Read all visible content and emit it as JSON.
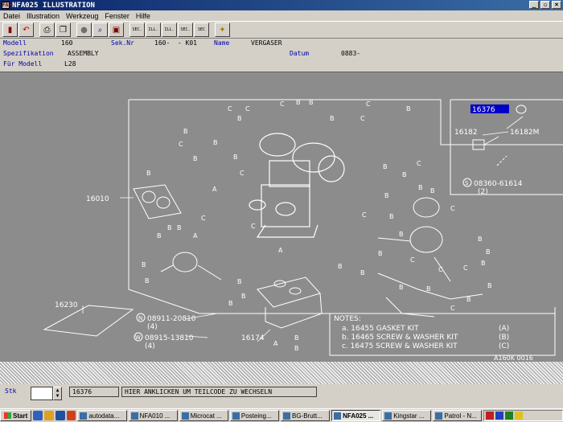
{
  "window": {
    "title": "NFA025 ILLUSTRATION",
    "app_icon": "FAST"
  },
  "menu": [
    "Datei",
    "Illustration",
    "Werkzeug",
    "Fenster",
    "Hilfe"
  ],
  "toolbar": {
    "sec_prev": "SEC.",
    "ill_prev": "ILL.",
    "ill_next": "ILL.",
    "sec_next": "SEC.",
    "sec_up": "SEC"
  },
  "info": {
    "modell_label": "Modell",
    "modell_value": "160",
    "seknr_label": "Sek.Nr",
    "seknr_value": "160-  - K01",
    "name_label": "Name",
    "name_value": "VERGASER",
    "spez_label": "Spezifikation",
    "spez_value": "ASSEMBLY",
    "datum_label": "Datum",
    "datum_value": "0883-",
    "fuer_label": "Für Modell",
    "fuer_value": "L28"
  },
  "illustration": {
    "callouts": {
      "c16376": "16376",
      "c16182": "16182",
      "c16182m": "16182M",
      "c08360": "08360-61614",
      "c08360_qty": "(2)",
      "c16010": "16010",
      "c16230": "16230",
      "c08911": "08911-20810",
      "c08911_qty": "(4)",
      "c08915": "08915-13810",
      "c08915_qty": "(4)",
      "c16174": "16174",
      "bolt_s": "S",
      "nut_n": "N",
      "washer_w": "W"
    },
    "notes": {
      "title": "NOTES:",
      "a": "a. 16455 GASKET KIT",
      "a_tag": "(A)",
      "b": "b. 16465 SCREW & WASHER KIT",
      "b_tag": "(B)",
      "c": "c. 16475 SCREW & WASHER KIT",
      "c_tag": "(C)"
    },
    "ref": "A160K 0016"
  },
  "bottom": {
    "stk_label": "Stk",
    "part_code": "16376",
    "message": "HIER ANKLICKEN UM TEILCODE ZU WECHSELN"
  },
  "taskbar": {
    "start": "Start",
    "tasks": [
      "autodata...",
      "NFA010 ...",
      "Microcat ...",
      "Posteing...",
      "BG-Brutt...",
      "NFA025 ...",
      "Kingstar ...",
      "Patrol - N..."
    ],
    "active_task": "NFA025 ..."
  }
}
